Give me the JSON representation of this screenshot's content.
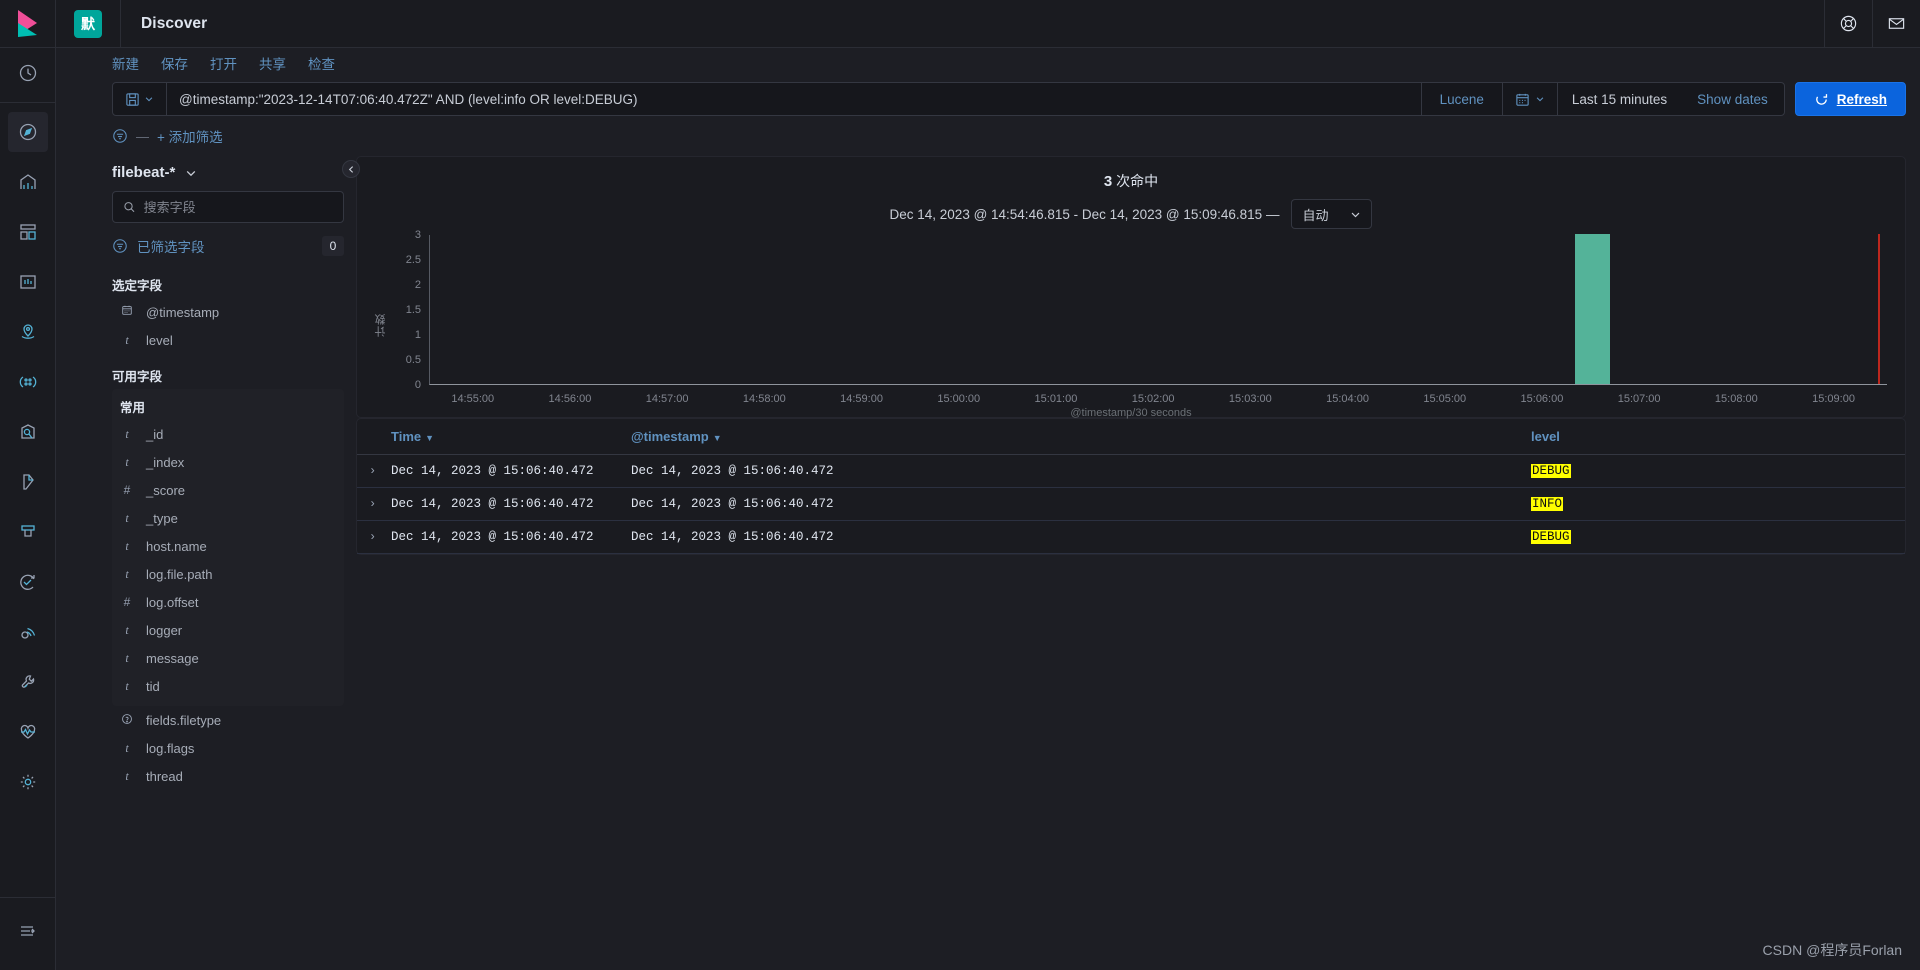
{
  "topbar": {
    "space_badge": "默",
    "app_title": "Discover",
    "help_icon": "lifebuoy-icon",
    "news_icon": "mail-icon"
  },
  "menu": {
    "items": [
      {
        "label": "新建",
        "name": "menu-new"
      },
      {
        "label": "保存",
        "name": "menu-save"
      },
      {
        "label": "打开",
        "name": "menu-open"
      },
      {
        "label": "共享",
        "name": "menu-share"
      },
      {
        "label": "检查",
        "name": "menu-inspect"
      }
    ]
  },
  "query_bar": {
    "saved_query_icon": "save-icon",
    "query": "@timestamp:\"2023-12-14T07:06:40.472Z\" AND (level:info OR level:DEBUG)",
    "language": "Lucene",
    "calendar_icon": "calendar-icon",
    "time_range": "Last 15 minutes",
    "show_dates": "Show dates",
    "refresh": "Refresh",
    "refresh_icon": "refresh-icon",
    "refresh_color": "#0b64dd"
  },
  "filter_bar": {
    "filter_icon": "filter-icon",
    "dash": "—",
    "add_filter": "+ 添加筛选"
  },
  "sidebar": {
    "index_pattern": "filebeat-*",
    "index_caret_icon": "chevron-down-icon",
    "search_icon": "search-icon",
    "search_placeholder": "搜索字段",
    "search_value": "",
    "filtered_fields_icon": "filter-icon",
    "filtered_fields_label": "已筛选字段",
    "filtered_fields_count": "0",
    "selected_fields_title": "选定字段",
    "selected_fields": [
      {
        "name": "@timestamp",
        "type": "date"
      },
      {
        "name": "level",
        "type": "string"
      }
    ],
    "available_fields_title": "可用字段",
    "popular_title": "常用",
    "popular_fields": [
      {
        "name": "_id",
        "type": "string"
      },
      {
        "name": "_index",
        "type": "string"
      },
      {
        "name": "_score",
        "type": "number"
      },
      {
        "name": "_type",
        "type": "string"
      },
      {
        "name": "host.name",
        "type": "string"
      },
      {
        "name": "log.file.path",
        "type": "string"
      },
      {
        "name": "log.offset",
        "type": "number"
      },
      {
        "name": "logger",
        "type": "string"
      },
      {
        "name": "message",
        "type": "string"
      },
      {
        "name": "tid",
        "type": "string"
      }
    ],
    "other_fields": [
      {
        "name": "fields.filetype",
        "type": "unknown"
      },
      {
        "name": "log.flags",
        "type": "string"
      },
      {
        "name": "thread",
        "type": "string"
      }
    ]
  },
  "content": {
    "collapse_icon": "chevron-left-icon",
    "hits_count": "3",
    "hits_label": "次命中",
    "range_text": "Dec 14, 2023 @ 14:54:46.815 - Dec 14, 2023 @ 15:09:46.815 —",
    "interval_value": "自动",
    "interval_caret_icon": "chevron-down-icon"
  },
  "chart_data": {
    "type": "bar",
    "title": "",
    "xlabel": "@timestamp/30 seconds",
    "ylabel": "计数",
    "ylim": [
      0,
      3
    ],
    "yticks": [
      0,
      0.5,
      1,
      1.5,
      2,
      2.5,
      3
    ],
    "xticks": [
      "14:55:00",
      "14:56:00",
      "14:57:00",
      "14:58:00",
      "14:59:00",
      "15:00:00",
      "15:01:00",
      "15:02:00",
      "15:03:00",
      "15:04:00",
      "15:05:00",
      "15:06:00",
      "15:07:00",
      "15:08:00",
      "15:09:00"
    ],
    "xlim": [
      "14:54:46.815",
      "15:09:46.815"
    ],
    "categories": [
      "15:06:30"
    ],
    "values": [
      3
    ],
    "bar_color": "#54b399",
    "grid": false,
    "legend": "none",
    "annotations": [
      {
        "type": "vertical-line",
        "label": "current time",
        "x": "15:09:46.815",
        "color": "#bd271e"
      }
    ]
  },
  "table": {
    "columns": [
      {
        "label": "Time",
        "sortable": true
      },
      {
        "label": "@timestamp",
        "sortable": true
      },
      {
        "label": "level",
        "sortable": false
      }
    ],
    "rows": [
      {
        "time": "Dec 14, 2023 @ 15:06:40.472",
        "timestamp": "Dec 14, 2023 @ 15:06:40.472",
        "level": "DEBUG"
      },
      {
        "time": "Dec 14, 2023 @ 15:06:40.472",
        "timestamp": "Dec 14, 2023 @ 15:06:40.472",
        "level": "INFO"
      },
      {
        "time": "Dec 14, 2023 @ 15:06:40.472",
        "timestamp": "Dec 14, 2023 @ 15:06:40.472",
        "level": "DEBUG"
      }
    ],
    "expand_icon": "chevron-right-icon",
    "highlight_color": "#ffff00"
  },
  "watermark": "CSDN @程序员Forlan"
}
